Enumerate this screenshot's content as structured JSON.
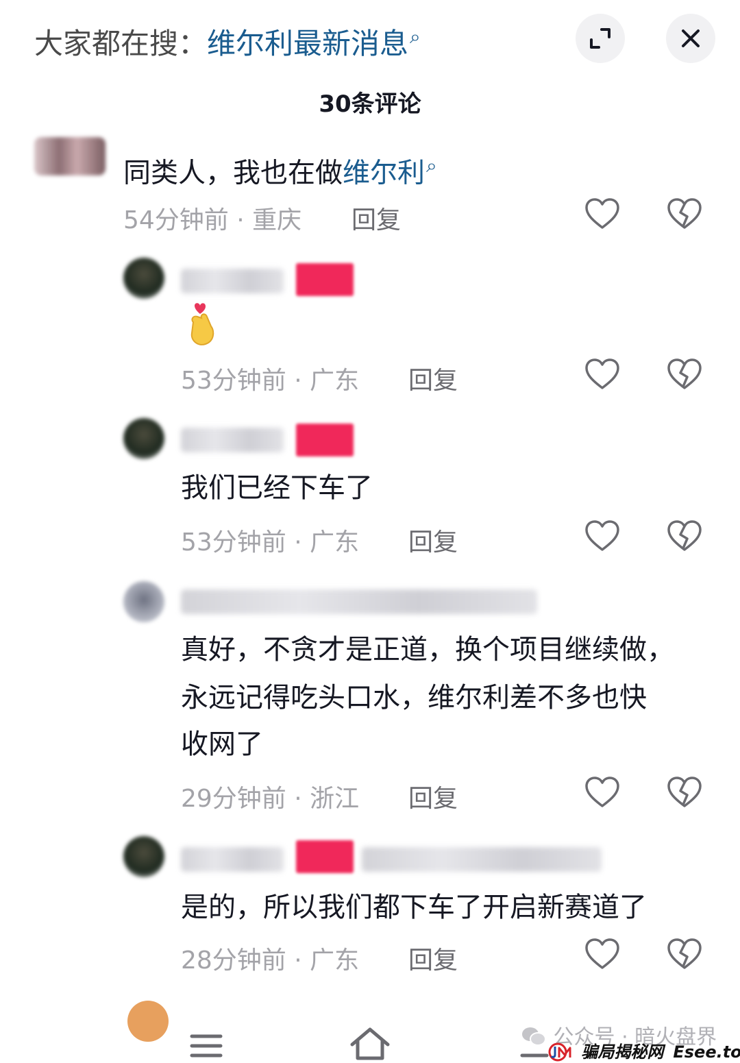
{
  "header": {
    "search_prefix": "大家都在搜：",
    "search_keyword": "维尔利最新消息",
    "comment_count": "30条评论"
  },
  "icons": {
    "expand": "expand-icon",
    "close": "close-icon",
    "search": "search-icon",
    "like": "heart-outline-icon",
    "dislike": "broken-heart-icon"
  },
  "colors": {
    "keyword": "#1a5c8f",
    "badge": "#f0285a",
    "meta": "#a3a3a8"
  },
  "comments": [
    {
      "text_plain": "同类人，我也在做",
      "text_keyword": "维尔利",
      "time": "54分钟前",
      "location": "重庆",
      "reply": "回复"
    },
    {
      "text": "",
      "emoji": "finger-heart-emoji",
      "time": "53分钟前",
      "location": "广东",
      "reply": "回复"
    },
    {
      "text": "我们已经下车了",
      "time": "53分钟前",
      "location": "广东",
      "reply": "回复"
    },
    {
      "lines": [
        "真好，不贪才是正道，换个项目继续做，",
        "永远记得吃头口水，维尔利差不多也快",
        "收网了"
      ],
      "time": "29分钟前",
      "location": "浙江",
      "reply": "回复"
    },
    {
      "text": "是的，所以我们都下车了开启新赛道了",
      "time": "28分钟前",
      "location": "广东",
      "reply": "回复"
    }
  ],
  "watermark": {
    "account": "公众号 · 暗火盘界",
    "brand": "骗局揭秘网",
    "site": "Esee.top"
  },
  "separator": " · "
}
